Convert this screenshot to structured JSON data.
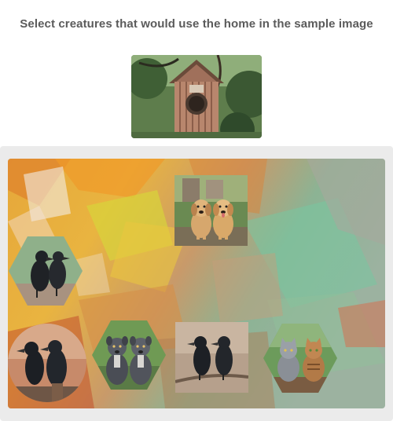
{
  "instruction": "Select creatures that would use the home in the sample image",
  "sample_image": {
    "subject": "birdhouse",
    "icon": "birdhouse-image"
  },
  "options": [
    {
      "id": "dogs",
      "subject": "two puppies",
      "icon": "puppies-image"
    },
    {
      "id": "crows-left",
      "subject": "two crows",
      "icon": "crows-image"
    },
    {
      "id": "crows-circle",
      "subject": "two crows",
      "icon": "crows-image"
    },
    {
      "id": "pitbulls",
      "subject": "two dogs",
      "icon": "dogs-image"
    },
    {
      "id": "crows-center",
      "subject": "two crows",
      "icon": "crows-image"
    },
    {
      "id": "cats",
      "subject": "two cats",
      "icon": "cats-image"
    }
  ],
  "colors": {
    "instruction_text": "#5b5b5b",
    "tray_background": "#ebebeb"
  }
}
